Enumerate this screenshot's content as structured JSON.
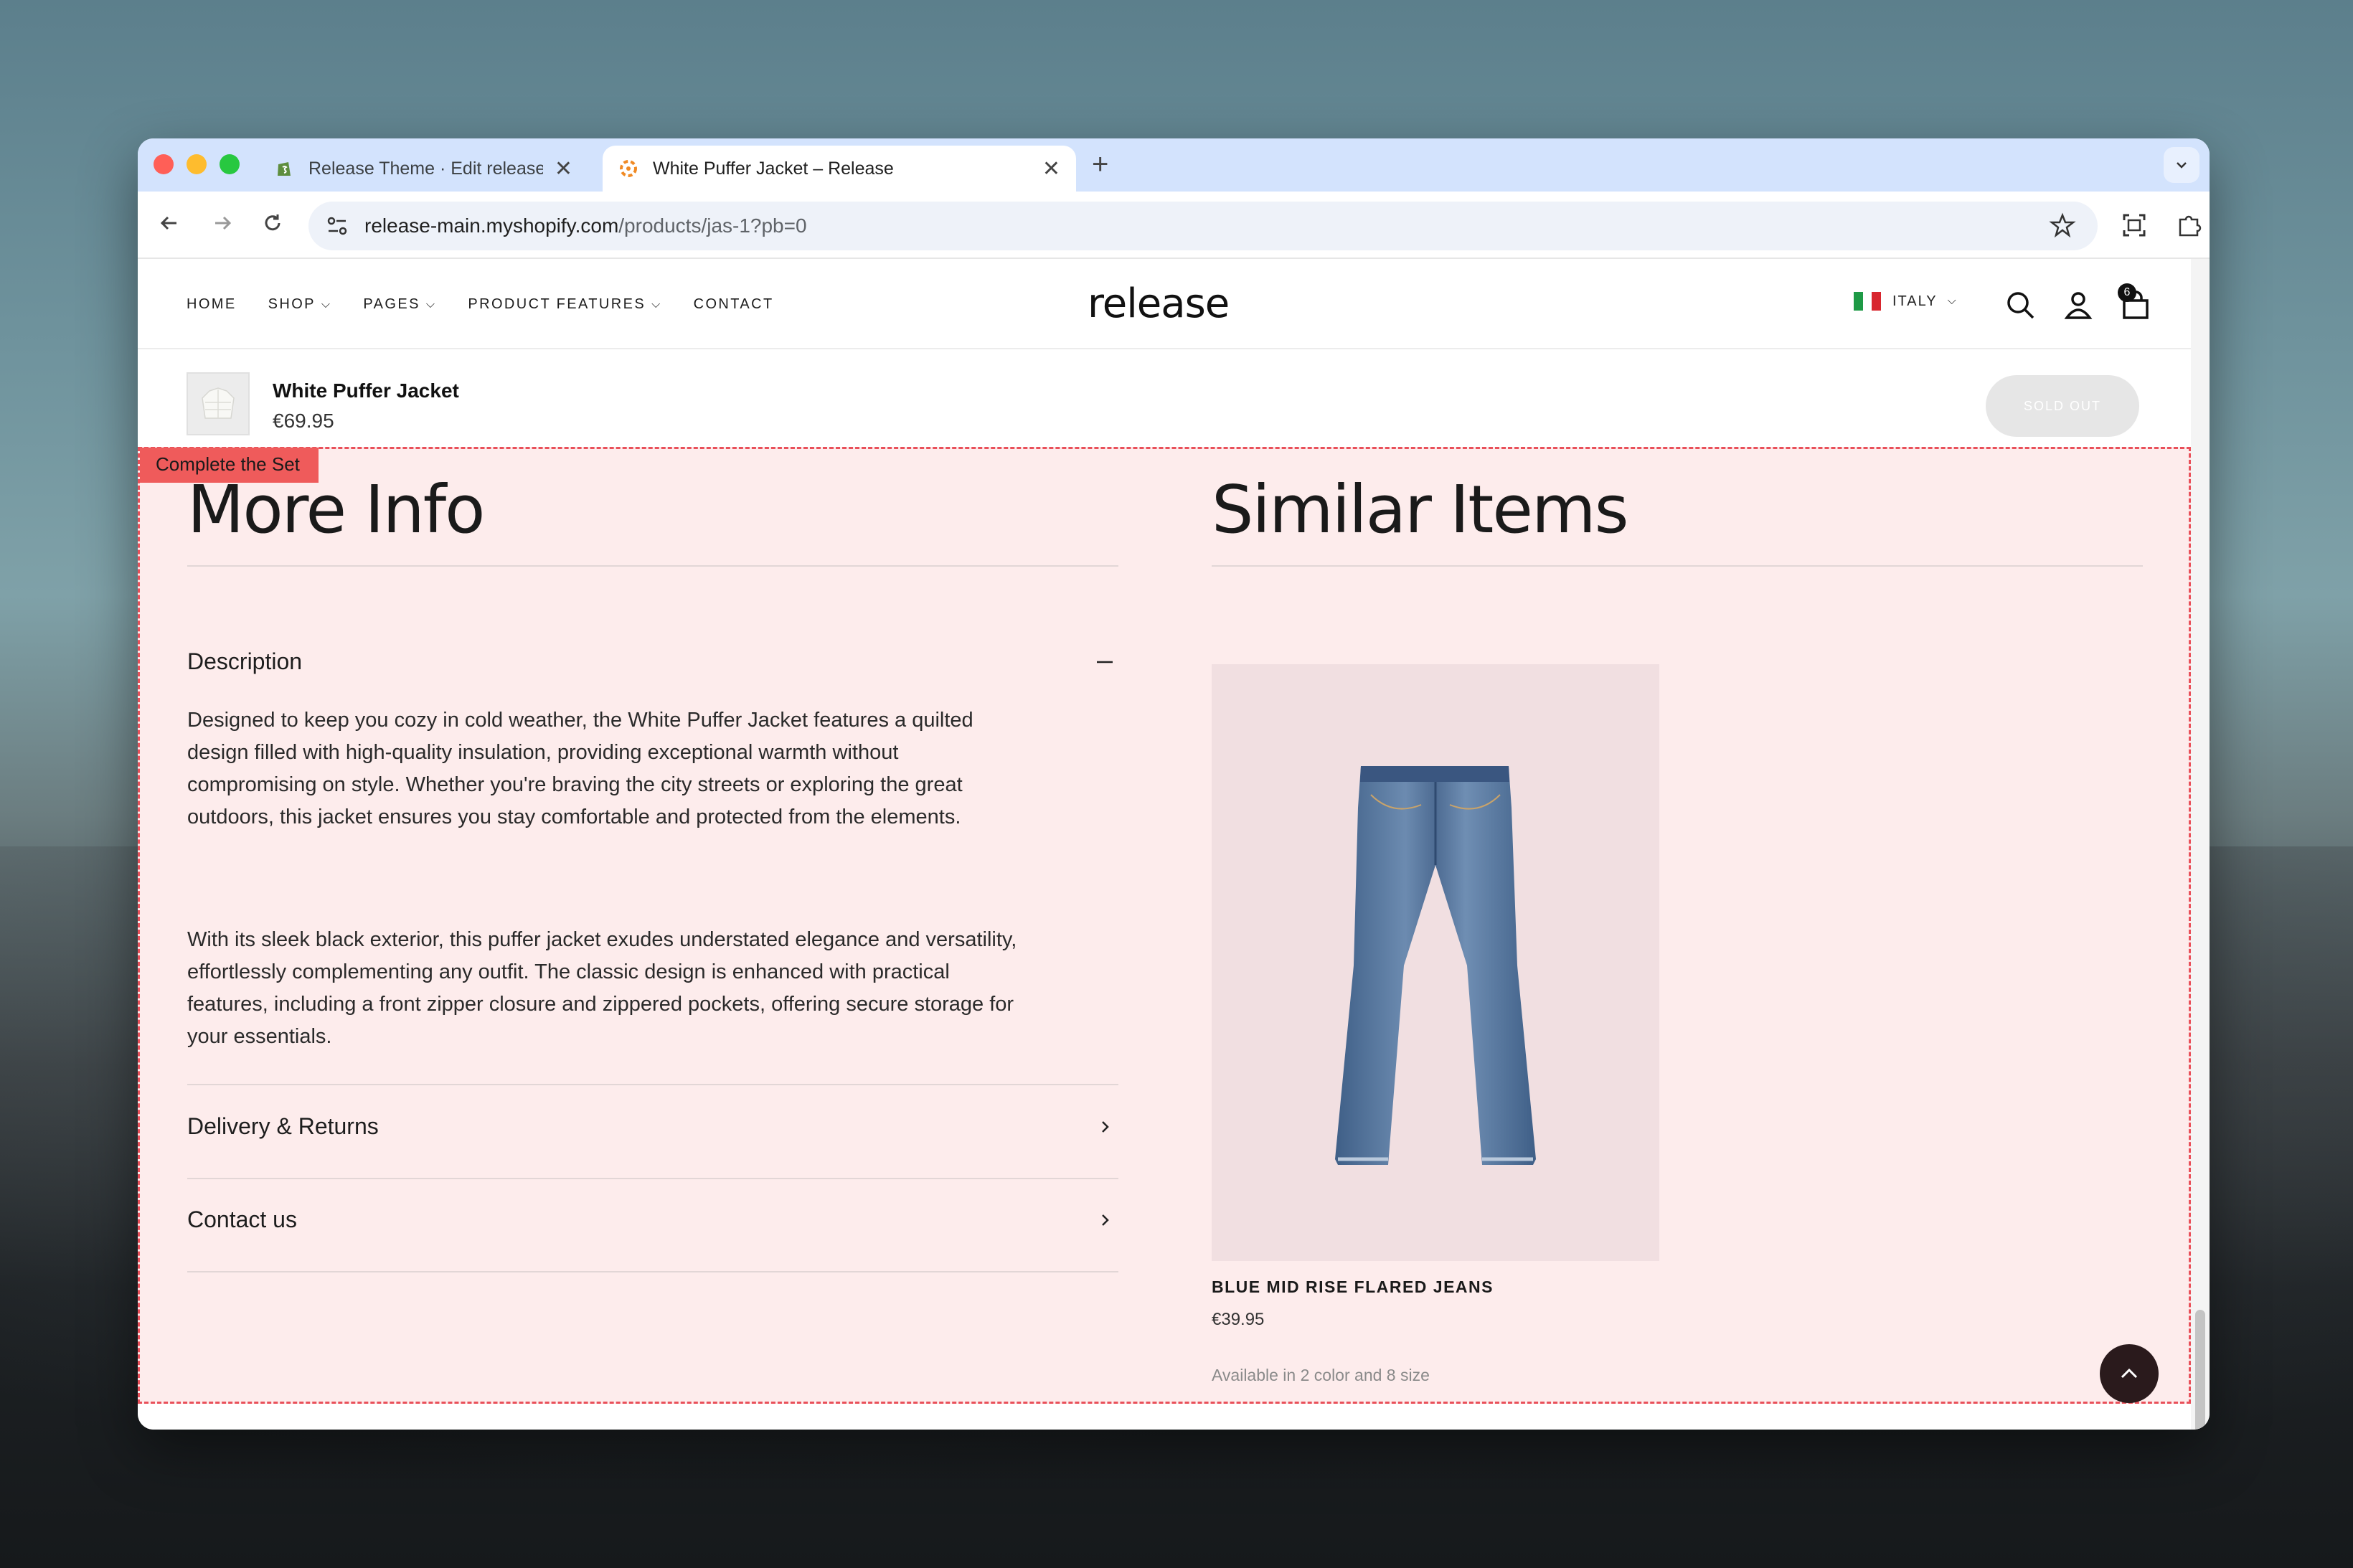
{
  "browser": {
    "tabs": [
      {
        "title": "Release Theme · Edit release",
        "close": "✕"
      },
      {
        "title": "White Puffer Jacket – Release",
        "close": "✕"
      }
    ],
    "new_tab": "+",
    "url_host": "release-main.myshopify.com",
    "url_path": "/products/jas-1?pb=0"
  },
  "header": {
    "nav": [
      "HOME",
      "SHOP",
      "PAGES",
      "PRODUCT FEATURES",
      "CONTACT"
    ],
    "logo": "release",
    "region": "ITALY",
    "cart_count": "6"
  },
  "sticky_bar": {
    "product_name": "White Puffer Jacket",
    "price": "€69.95",
    "button": "SOLD OUT"
  },
  "section": {
    "tag": "Complete the Set",
    "more_info": {
      "heading": "More Info",
      "description_title": "Description",
      "description_p1": "Designed to keep you cozy in cold weather, the White Puffer Jacket features a quilted design filled with high-quality insulation, providing exceptional warmth without compromising on style. Whether you're braving the city streets or exploring the great outdoors, this jacket ensures you stay comfortable and protected from the elements.",
      "description_p2": "With its sleek black exterior, this puffer jacket exudes understated elegance and versatility, effortlessly complementing any outfit. The classic design is enhanced with practical features, including a front zipper closure and zippered pockets, offering secure storage for your essentials.",
      "delivery": "Delivery & Returns",
      "contact": "Contact us"
    },
    "similar": {
      "heading": "Similar Items",
      "product_title": "BLUE MID RISE FLARED JEANS",
      "product_price": "€39.95",
      "availability": "Available in 2 color and 8 size"
    }
  },
  "colors": {
    "section_bg": "#fdecec",
    "tag": "#ef5b5b",
    "tab_strip": "#d3e3fd"
  }
}
